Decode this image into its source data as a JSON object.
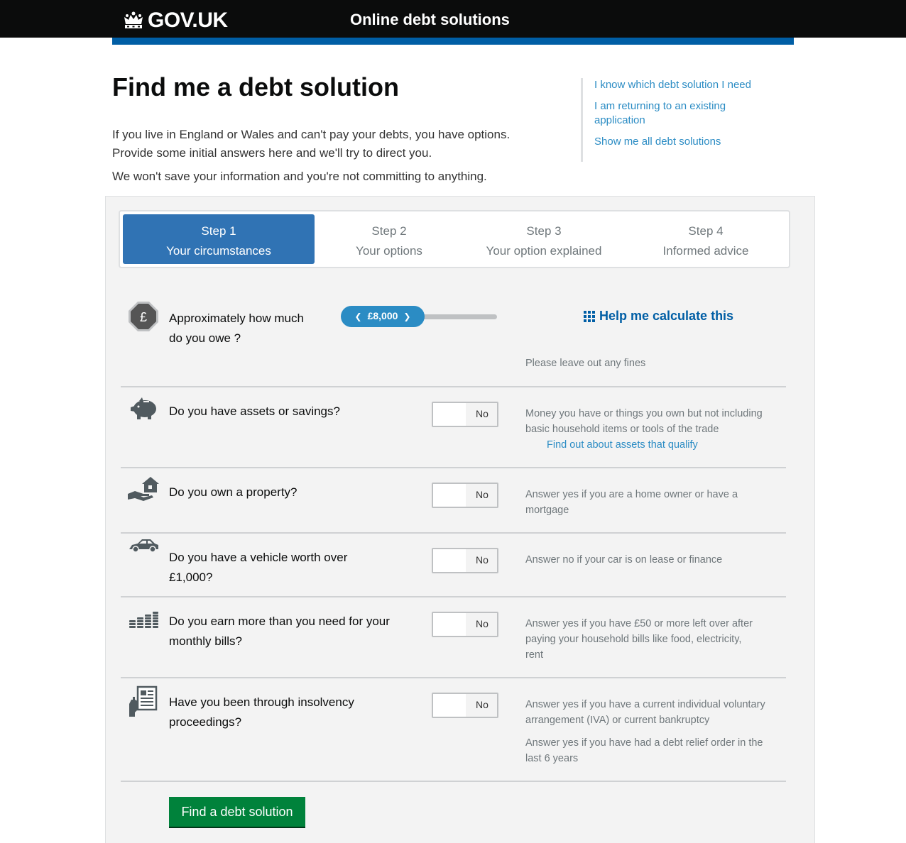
{
  "header": {
    "logotype": "GOV.UK",
    "service_name": "Online debt solutions"
  },
  "page": {
    "title": "Find me a debt solution",
    "intro_line1": "If you live in England or Wales and can't pay your debts, you have options.",
    "intro_line2": "Provide some initial answers here and we'll try to direct you.",
    "intro_note": "We won't save your information and you're not committing to anything."
  },
  "related_links": [
    "I know which debt solution I need",
    "I am returning to an existing application",
    "Show me all debt solutions"
  ],
  "steps": [
    {
      "num": "Step 1",
      "name": "Your circumstances",
      "active": true
    },
    {
      "num": "Step 2",
      "name": "Your options",
      "active": false
    },
    {
      "num": "Step 3",
      "name": "Your option explained",
      "active": false
    },
    {
      "num": "Step 4",
      "name": "Informed advice",
      "active": false
    }
  ],
  "debt_question": {
    "label_line1": "Approximately how much",
    "label_line2": "do you owe ?",
    "slider_value": "£8,000",
    "help_link": "Help me calculate this",
    "hint": "Please leave out any fines"
  },
  "questions": [
    {
      "icon": "piggy-bank-icon",
      "label_line1": "Do you have assets or savings?",
      "label_line2": "",
      "toggle": "No",
      "hint_line1": "Money you have or things you own but not including",
      "hint_line2": "basic household items or tools of the trade",
      "link": "Find out about assets that qualify"
    },
    {
      "icon": "house-in-hand-icon",
      "label_line1": "Do you own a property?",
      "label_line2": "",
      "toggle": "No",
      "hint_line1": "Answer yes if you are a home owner or have a",
      "hint_line2": "mortgage"
    },
    {
      "icon": "car-icon",
      "label_line1": "Do you have a vehicle worth over",
      "label_line2": "£1,000?",
      "toggle": "No",
      "hint_line1": "Answer no if your car is on lease or finance",
      "hint_line2": ""
    },
    {
      "icon": "coin-stacks-icon",
      "label_line1": "Do you earn more than you need for your",
      "label_line2": "monthly bills?",
      "toggle": "No",
      "hint_line1": "Answer yes if you have £50 or more left over after",
      "hint_line2": "paying your household bills like food, electricity,",
      "hint_line3": "rent"
    },
    {
      "icon": "document-in-hand-icon",
      "label_line1": "Have you been through insolvency",
      "label_line2": "proceedings?",
      "toggle": "No",
      "hint_line1": "Answer yes if you have a current individual voluntary",
      "hint_line2": "arrangement (IVA) or current bankruptcy",
      "hint_line3": "Answer yes if you have had a debt relief order in the",
      "hint_line4": "last 6 years"
    }
  ],
  "submit_label": "Find a debt solution"
}
